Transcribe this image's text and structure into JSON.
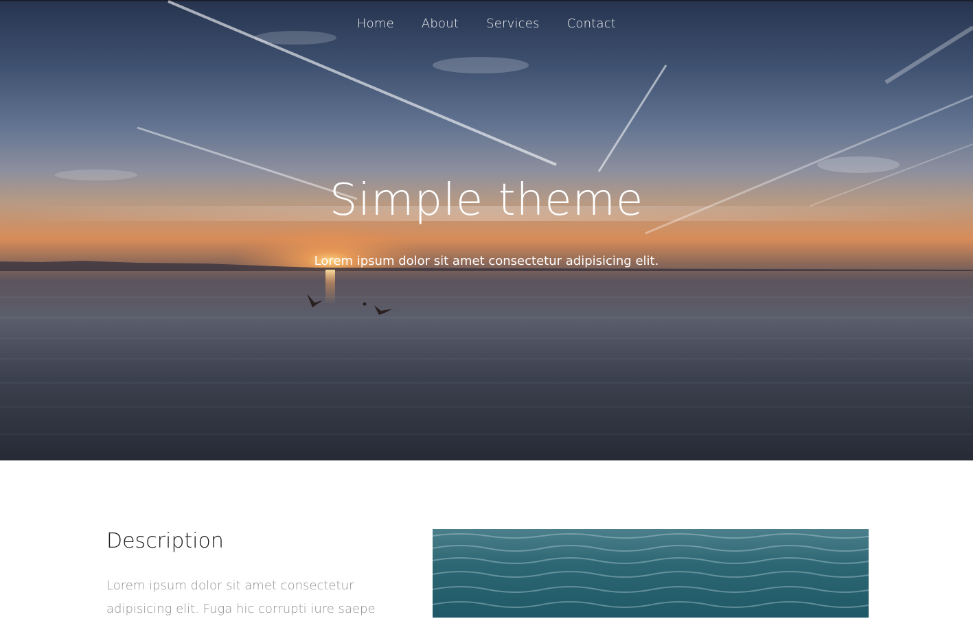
{
  "nav": {
    "items": [
      {
        "label": "Home"
      },
      {
        "label": "About"
      },
      {
        "label": "Services"
      },
      {
        "label": "Contact"
      }
    ]
  },
  "hero": {
    "title": "Simple theme",
    "subtitle": "Lorem ipsum dolor sit amet consectetur adipisicing elit."
  },
  "description": {
    "heading": "Description",
    "text": "Lorem ipsum dolor sit amet consectetur adipisicing elit. Fuga hic corrupti iure saepe"
  },
  "colors": {
    "text_light": "#ffffff",
    "heading_dark": "#1c1c1c",
    "body_gray": "#8d8d8d"
  }
}
